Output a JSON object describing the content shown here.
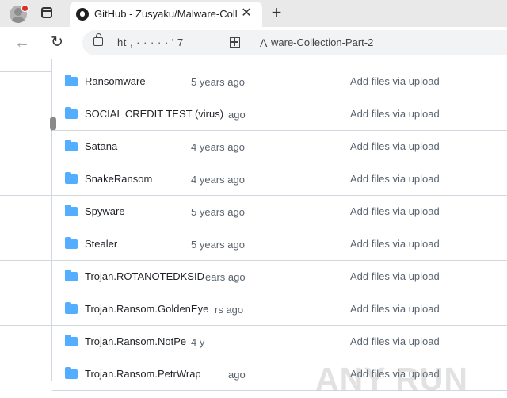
{
  "tab": {
    "title": "GitHub - Zusyaku/Malware-Collec",
    "close_label": "✕"
  },
  "new_tab_label": "+",
  "address_bar": {
    "url_left": "ht  ,  ·  ·  ·  ·  ·  '   7",
    "url_right": "ware-Collection-Part-2"
  },
  "files": [
    {
      "name": "Ransomware",
      "age": "5 years ago",
      "message": "Add files via upload"
    },
    {
      "name": "SOCIAL CREDIT TEST (virus)",
      "age": "ago",
      "message": "Add files via upload"
    },
    {
      "name": "Satana",
      "age": "4 years ago",
      "message": "Add files via upload"
    },
    {
      "name": "SnakeRansom",
      "age": "4 years ago",
      "message": "Add files via upload"
    },
    {
      "name": "Spyware",
      "age": "5 years ago",
      "message": "Add files via upload"
    },
    {
      "name": "Stealer",
      "age": "5 years ago",
      "message": "Add files via upload"
    },
    {
      "name": "Trojan.ROTANOTEDKSID",
      "age": "ears ago",
      "message": "Add files via upload"
    },
    {
      "name": "Trojan.Ransom.GoldenEye",
      "age": "rs ago",
      "message": "Add files via upload"
    },
    {
      "name": "Trojan.Ransom.NotPe",
      "age": "4 y",
      "message": "Add files via upload"
    },
    {
      "name": "Trojan.Ransom.PetrWrap",
      "age": "ago",
      "message": "Add files via upload"
    }
  ],
  "watermark": "ANY RUN",
  "colors": {
    "folder": "#54aeff",
    "tabbar": "#e9e9ea",
    "border": "#d0d7de"
  }
}
